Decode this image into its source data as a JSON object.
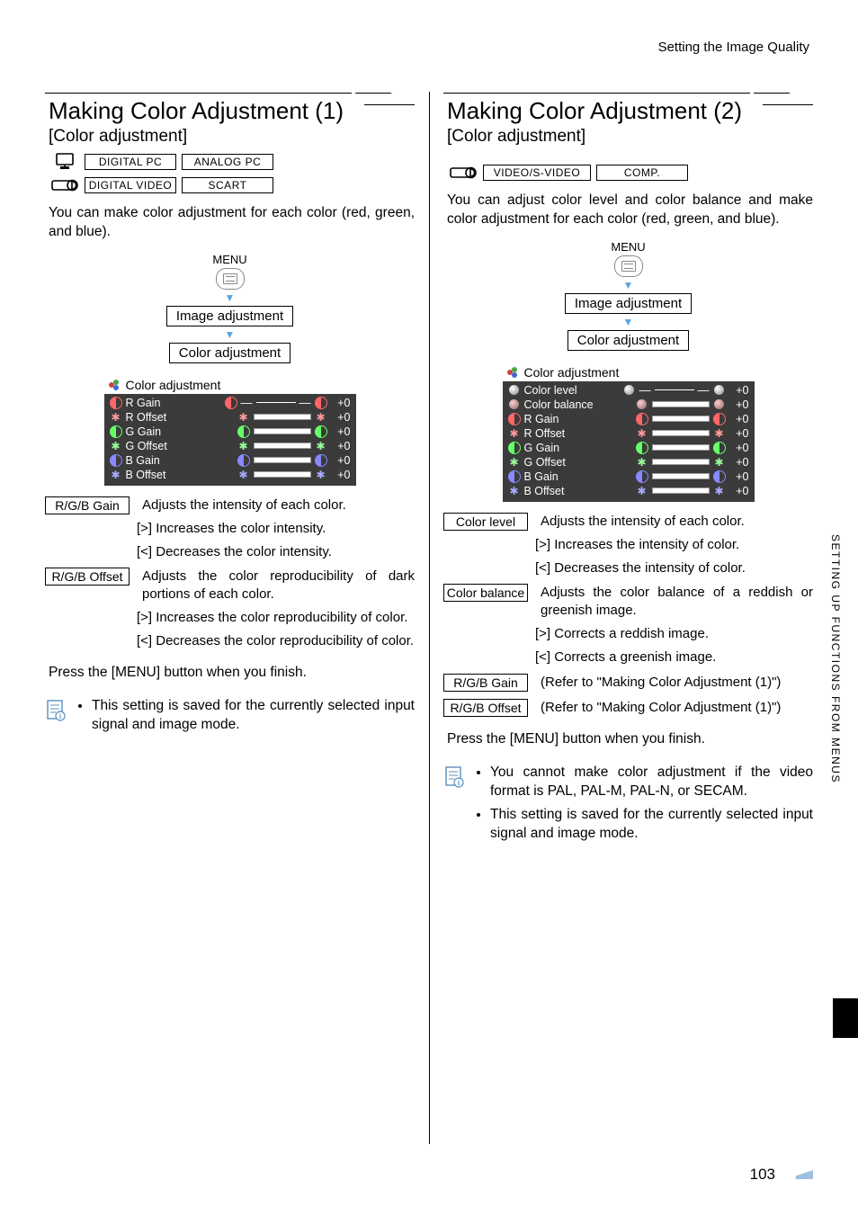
{
  "header": "Setting the Image Quality",
  "side_tab": "SETTING UP FUNCTIONS FROM MENUS",
  "page_number": "103",
  "nav": {
    "menu_label": "MENU",
    "step1": "Image adjustment",
    "step2": "Color adjustment"
  },
  "left": {
    "title": "Making Color Adjustment (1)",
    "subtitle": "[Color adjustment]",
    "tags_row1": [
      "DIGITAL PC",
      "ANALOG PC"
    ],
    "tags_row2": [
      "DIGITAL VIDEO",
      "SCART"
    ],
    "intro": "You can make color adjustment for each color (red, green, and blue).",
    "osd_title": "Color adjustment",
    "osd_rows": [
      {
        "name": "R Gain",
        "val": "+0"
      },
      {
        "name": "R Offset",
        "val": "+0"
      },
      {
        "name": "G Gain",
        "val": "+0"
      },
      {
        "name": "G Offset",
        "val": "+0"
      },
      {
        "name": "B Gain",
        "val": "+0"
      },
      {
        "name": "B Offset",
        "val": "+0"
      }
    ],
    "desc": [
      {
        "label": "R/G/B Gain",
        "text": "Adjusts the intensity of each color.",
        "subs": [
          "[>] Increases the color intensity.",
          "[<] Decreases the color intensity."
        ]
      },
      {
        "label": "R/G/B Offset",
        "text": "Adjusts the color reproducibility of dark portions of each color.",
        "subs": [
          "[>] Increases the color reproducibility of color.",
          "[<] Decreases the color reproducibility of color."
        ]
      }
    ],
    "footer": "Press the [MENU] button when you finish.",
    "notes": [
      "This setting is saved for the currently selected input signal and image mode."
    ]
  },
  "right": {
    "title": "Making Color Adjustment (2)",
    "subtitle": "[Color adjustment]",
    "tags_row1": [
      "VIDEO/S-VIDEO",
      "COMP."
    ],
    "intro": "You can adjust color level and color balance and make color adjustment for each color (red, green, and blue).",
    "osd_title": "Color adjustment",
    "osd_rows": [
      {
        "name": "Color level",
        "val": "+0"
      },
      {
        "name": "Color balance",
        "val": "+0"
      },
      {
        "name": "R Gain",
        "val": "+0"
      },
      {
        "name": "R Offset",
        "val": "+0"
      },
      {
        "name": "G Gain",
        "val": "+0"
      },
      {
        "name": "G Offset",
        "val": "+0"
      },
      {
        "name": "B Gain",
        "val": "+0"
      },
      {
        "name": "B Offset",
        "val": "+0"
      }
    ],
    "desc": [
      {
        "label": "Color level",
        "text": "Adjusts the intensity of each color.",
        "subs": [
          "[>] Increases the intensity of color.",
          "[<] Decreases the intensity of color."
        ]
      },
      {
        "label": "Color balance",
        "text": "Adjusts the color balance of a reddish or greenish image.",
        "subs": [
          "[>] Corrects a reddish image.",
          "[<] Corrects a greenish image."
        ]
      },
      {
        "label": "R/G/B Gain",
        "text": "(Refer to \"Making Color Adjustment (1)\")",
        "subs": []
      },
      {
        "label": "R/G/B Offset",
        "text": "(Refer to \"Making Color Adjustment (1)\")",
        "subs": []
      }
    ],
    "footer": "Press the [MENU] button when you finish.",
    "notes": [
      "You cannot make color adjustment if the video format is PAL, PAL-M, PAL-N, or SECAM.",
      "This setting is saved for the currently selected input signal and image mode."
    ]
  }
}
